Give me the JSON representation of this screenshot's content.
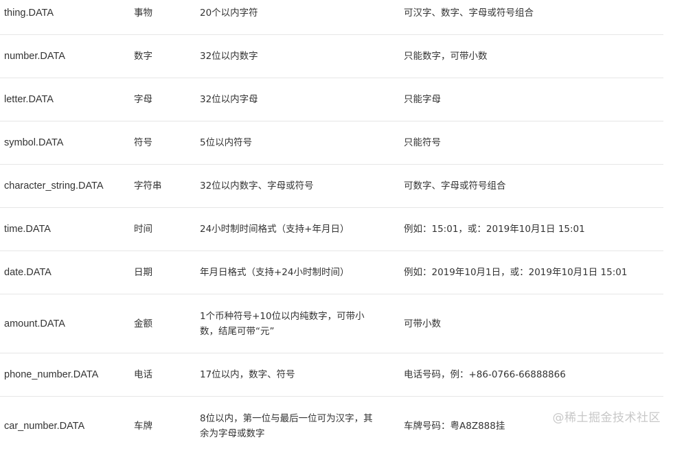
{
  "rows": [
    {
      "key": "thing.DATA",
      "name": "事物",
      "length": "20个以内字符",
      "desc": "可汉字、数字、字母或符号组合"
    },
    {
      "key": "number.DATA",
      "name": "数字",
      "length": "32位以内数字",
      "desc": "只能数字，可带小数"
    },
    {
      "key": "letter.DATA",
      "name": "字母",
      "length": "32位以内字母",
      "desc": "只能字母"
    },
    {
      "key": "symbol.DATA",
      "name": "符号",
      "length": "5位以内符号",
      "desc": "只能符号"
    },
    {
      "key": "character_string.DATA",
      "name": "字符串",
      "length": "32位以内数字、字母或符号",
      "desc": "可数字、字母或符号组合"
    },
    {
      "key": "time.DATA",
      "name": "时间",
      "length": "24小时制时间格式（支持+年月日）",
      "desc": "例如：15:01，或：2019年10月1日 15:01"
    },
    {
      "key": "date.DATA",
      "name": "日期",
      "length": "年月日格式（支持+24小时制时间）",
      "desc": "例如：2019年10月1日，或：2019年10月1日 15:01"
    },
    {
      "key": "amount.DATA",
      "name": "金额",
      "length": "1个币种符号+10位以内纯数字，可带小数，结尾可带“元”",
      "desc": "可带小数"
    },
    {
      "key": "phone_number.DATA",
      "name": "电话",
      "length": "17位以内，数字、符号",
      "desc": "电话号码，例：+86-0766-66888866"
    },
    {
      "key": "car_number.DATA",
      "name": "车牌",
      "length": "8位以内，第一位与最后一位可为汉字，其余为字母或数字",
      "desc": "车牌号码：粤A8Z888挂"
    }
  ],
  "watermark": "@稀土掘金技术社区"
}
